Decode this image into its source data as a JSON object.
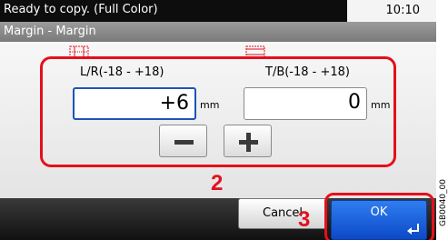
{
  "status": {
    "message": "Ready to copy. (Full Color)",
    "time": "10:10"
  },
  "header": {
    "title": "Margin - Margin"
  },
  "margin": {
    "lr": {
      "label": "L/R(-18 - +18)",
      "value": "+6",
      "unit": "mm"
    },
    "tb": {
      "label": "T/B(-18 - +18)",
      "value": "0",
      "unit": "mm"
    }
  },
  "buttons": {
    "cancel": "Cancel",
    "ok": "OK"
  },
  "callouts": {
    "step2": "2",
    "step3": "3"
  },
  "figure_id": "GB0040_00",
  "colors": {
    "highlight": "#e3101c",
    "active_border": "#1d55b5",
    "ok_button": "#1a5fd8"
  }
}
